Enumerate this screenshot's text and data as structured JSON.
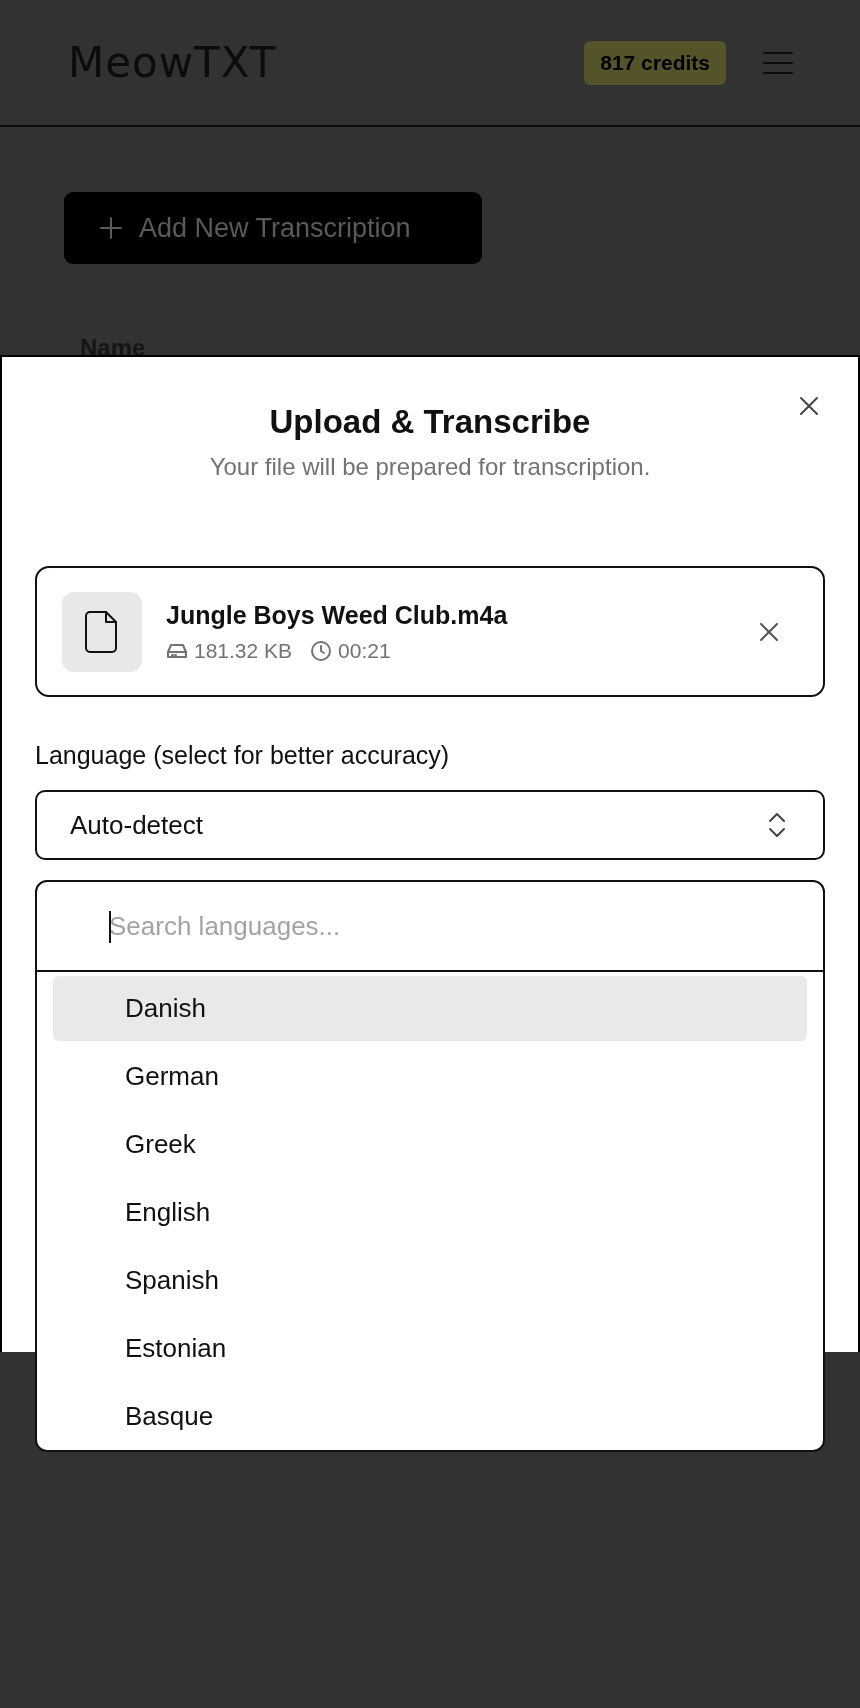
{
  "header": {
    "logo": "MeowTXT",
    "credits": "817 credits"
  },
  "page": {
    "add_button": "Add New Transcription",
    "column_header": "Name"
  },
  "dialog": {
    "title": "Upload & Transcribe",
    "subtitle": "Your file will be prepared for transcription.",
    "file": {
      "name": "Jungle Boys Weed Club.m4a",
      "size": "181.32 KB",
      "duration": "00:21"
    },
    "language_label": "Language (select for better accuracy)",
    "language_value": "Auto-detect",
    "dropdown": {
      "placeholder": "Search languages...",
      "options": [
        {
          "label": "Danish",
          "highlighted": true
        },
        {
          "label": "German",
          "highlighted": false
        },
        {
          "label": "Greek",
          "highlighted": false
        },
        {
          "label": "English",
          "highlighted": false
        },
        {
          "label": "Spanish",
          "highlighted": false
        },
        {
          "label": "Estonian",
          "highlighted": false
        },
        {
          "label": "Basque",
          "highlighted": false
        }
      ]
    }
  }
}
